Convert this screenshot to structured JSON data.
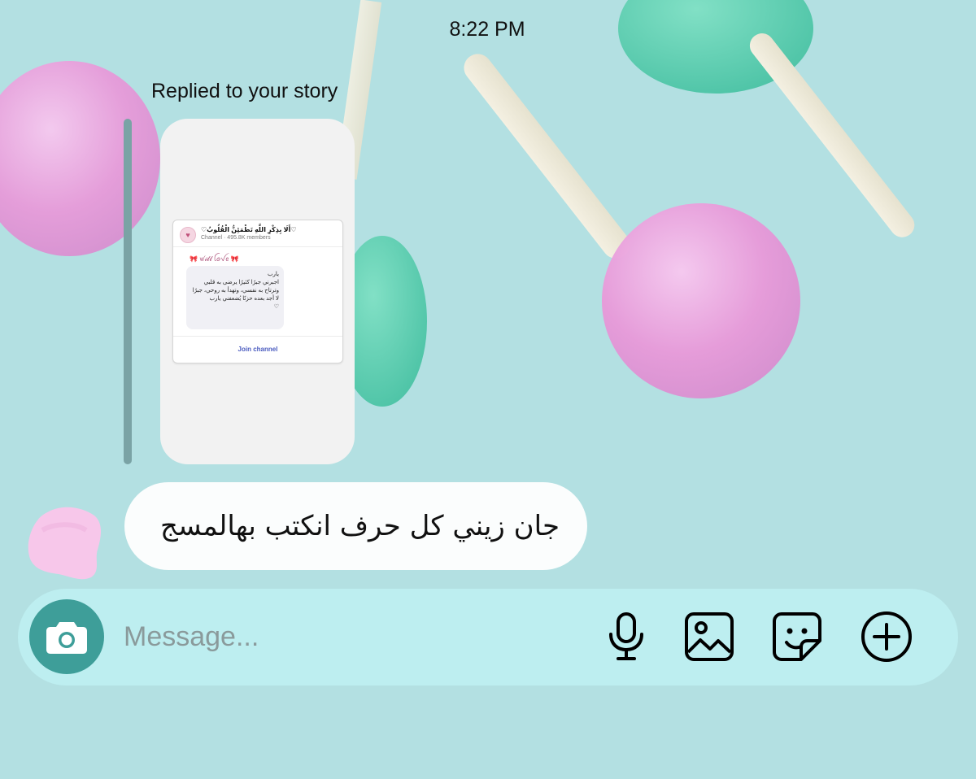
{
  "header": {
    "timestamp": "8:22 PM"
  },
  "reply": {
    "label": "Replied to your story",
    "story_preview": {
      "channel_name": "♡أَلَا بِذِكْرِ اللَّهِ تَطْمَئِنُّ الْقُلُوبُ♡",
      "channel_meta": "Channel · 495.8K members",
      "bow_line": "🎀 ꪝ𝓲𝓵𝓵 ꪶꪮꪜꫀ 🎀",
      "post_text": "يارب\nاجبرني جبرًا كثيرًا يرضى به قلبي\nوترتاح به نفسي، وتهدأ به روحي، جبرًا\nلا أجد بعده حزنًا يُضعفني يارب\n♡",
      "join_label": "Join channel"
    }
  },
  "message": {
    "text": "جان زيني كل حرف انكتب بهالمسج"
  },
  "composer": {
    "placeholder": "Message...",
    "icons": [
      "camera-icon",
      "microphone-icon",
      "image-icon",
      "sticker-icon",
      "add-icon"
    ],
    "camera_button_color": "#3e9e99"
  },
  "colors": {
    "background": "#b3e0e2",
    "composer_bg": "#bdeef0",
    "bubble_bg": "#fbfdfd",
    "lollipop_pink": "#eaa6e0",
    "lollipop_teal": "#56cfae"
  }
}
